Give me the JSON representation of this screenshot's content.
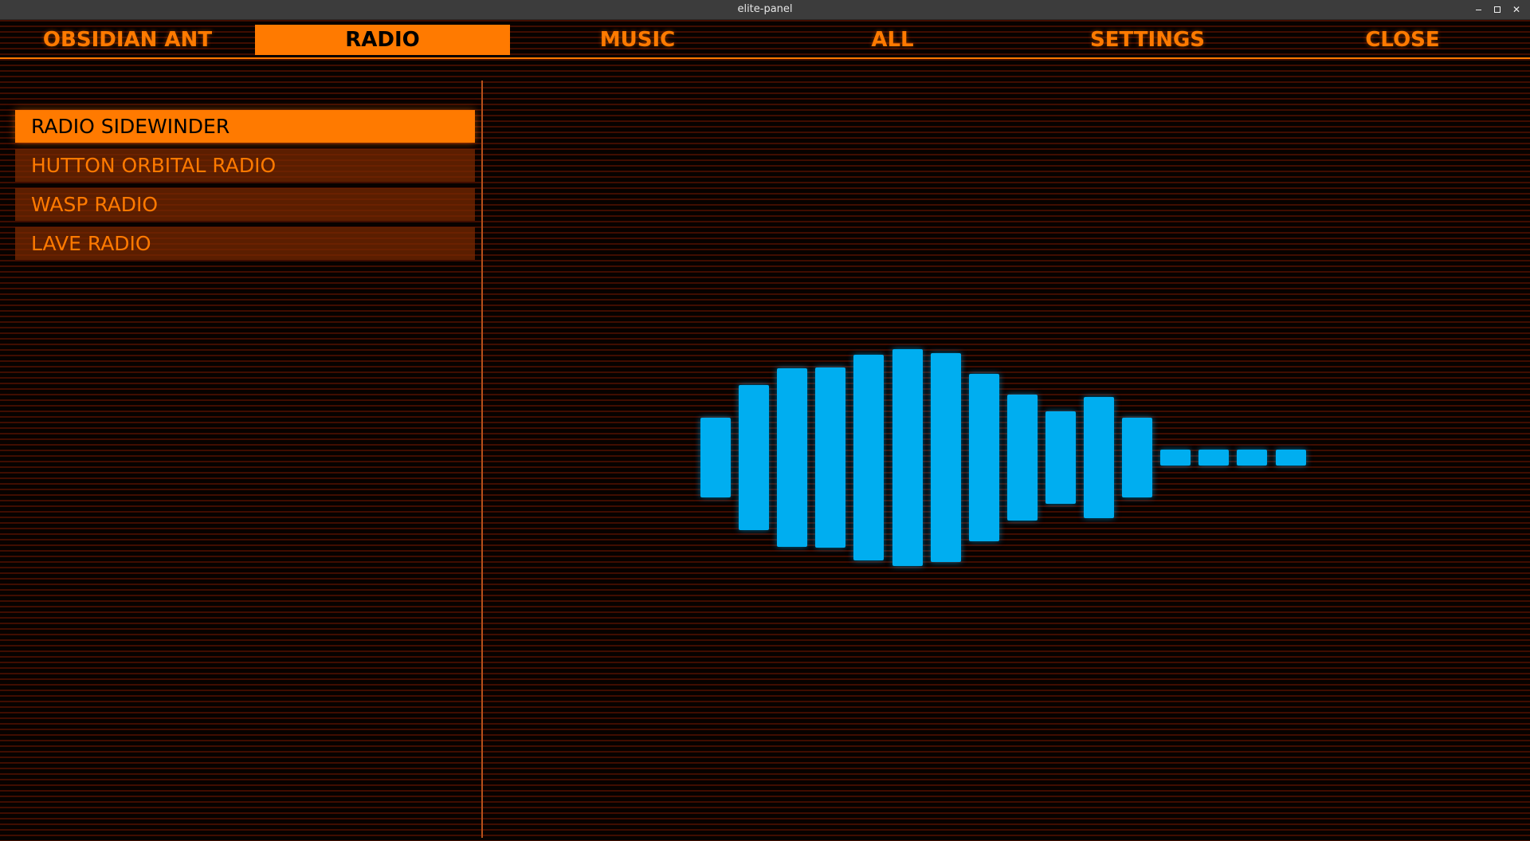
{
  "window": {
    "title": "elite-panel",
    "controls": [
      "minimize-icon",
      "maximize-icon",
      "close-icon"
    ],
    "close_glyph": "✕"
  },
  "nav": {
    "tabs": [
      {
        "label": "OBSIDIAN ANT",
        "active": false
      },
      {
        "label": "RADIO",
        "active": true
      },
      {
        "label": "MUSIC",
        "active": false
      },
      {
        "label": "ALL",
        "active": false
      },
      {
        "label": "SETTINGS",
        "active": false
      },
      {
        "label": "CLOSE",
        "active": false
      }
    ]
  },
  "stations": [
    {
      "label": "RADIO SIDEWINDER",
      "selected": true
    },
    {
      "label": "HUTTON ORBITAL RADIO",
      "selected": false
    },
    {
      "label": "WASP RADIO",
      "selected": false
    },
    {
      "label": "LAVE RADIO",
      "selected": false
    }
  ],
  "visualizer": {
    "levels": [
      0.37,
      0.67,
      0.82,
      0.83,
      0.95,
      1.0,
      0.96,
      0.77,
      0.58,
      0.43,
      0.56,
      0.37,
      0.07,
      0.07,
      0.07,
      0.07
    ]
  },
  "colors": {
    "accent": "#ff7a00",
    "accent_dark": "#782800",
    "visualizer": "#00aef0",
    "background": "#070200",
    "scanline": "#6e1600"
  }
}
